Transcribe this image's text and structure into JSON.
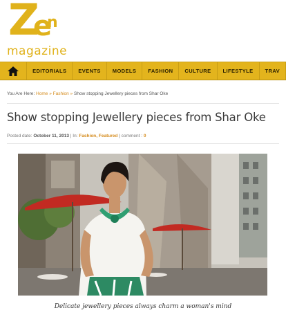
{
  "logo": {
    "letters_z": "Z",
    "letters_e": "e",
    "letters_n": "n",
    "subtitle": "magazine"
  },
  "nav": {
    "home_icon": "home-icon",
    "items": [
      "EDITORIALS",
      "EVENTS",
      "MODELS",
      "FASHION",
      "CULTURE",
      "LIFESTYLE",
      "TRAV"
    ]
  },
  "breadcrumb": {
    "prefix": "You Are Here:",
    "home": "Home",
    "sep1": "»",
    "fashion": "Fashion",
    "sep2": "»",
    "current": "Show stopping Jewellery pieces from Shar Oke"
  },
  "post": {
    "title": "Show stopping Jewellery pieces from Shar Oke",
    "posted_label": "Posted date:",
    "date": "October 11, 2013",
    "in_label": "| In:",
    "category1": "Fashion,",
    "category2": "Featured",
    "comment_label": "| comment :",
    "comment_count": "0"
  },
  "photo": {
    "caption": "Delicate jewellery pieces always charm a woman's mind"
  },
  "colors": {
    "accent": "#e3b41d",
    "link": "#d48a1a"
  }
}
